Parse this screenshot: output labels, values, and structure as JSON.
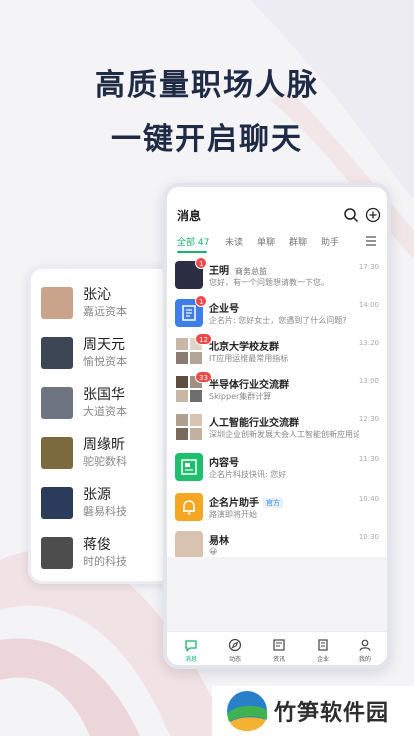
{
  "headline": {
    "line1": "高质量职场人脉",
    "line2": "一键开启聊天"
  },
  "contacts": [
    {
      "name": "张沁",
      "org": "嘉远资本",
      "avatar_color": "#c9a48a"
    },
    {
      "name": "周天元",
      "org": "愉悦资本",
      "avatar_color": "#3d4654"
    },
    {
      "name": "张国华",
      "org": "大道资本",
      "avatar_color": "#6e7480"
    },
    {
      "name": "周缘昕",
      "org": "驼驼数科",
      "avatar_color": "#7a6a3e"
    },
    {
      "name": "张源",
      "org": "磐易科技",
      "avatar_color": "#2a3b5c"
    },
    {
      "name": "蒋俊",
      "org": "时的科技",
      "avatar_color": "#4d4d4d"
    }
  ],
  "app": {
    "title": "消息",
    "icons": {
      "search": "search-icon",
      "add": "plus-circle-icon",
      "menu": "menu-icon"
    },
    "accent": "#19b26b",
    "tabs": [
      {
        "label": "全部 47",
        "active": true
      },
      {
        "label": "未读",
        "active": false
      },
      {
        "label": "单聊",
        "active": false
      },
      {
        "label": "群聊",
        "active": false
      },
      {
        "label": "助手",
        "active": false
      }
    ],
    "messages": [
      {
        "name": "王明",
        "title": "商务总监",
        "tag": "",
        "preview": "您好，有一个问题想请教一下您。",
        "time": "17:30",
        "badge": "1",
        "avatar": "person-photo",
        "avatar_color": "#2b2d42"
      },
      {
        "name": "企业号",
        "title": "",
        "tag": "",
        "preview": "企名片: 您好女士，您遇到了什么问题?",
        "time": "14:00",
        "badge": "1",
        "avatar": "enterprise-icon",
        "avatar_color": "#3f7ee8"
      },
      {
        "name": "北京大学校友群",
        "title": "",
        "tag": "",
        "preview": "IT应用运维最常用指标",
        "time": "13:20",
        "badge": "12",
        "avatar": "group-avatar",
        "avatar_color": "#c8b6a6"
      },
      {
        "name": "半导体行业交流群",
        "title": "",
        "tag": "",
        "preview": "Skipper集群计算",
        "time": "13:00",
        "badge": "33",
        "avatar": "group-avatar",
        "avatar_color": "#a09080"
      },
      {
        "name": "人工智能行业交流群",
        "title": "",
        "tag": "",
        "preview": "深圳企业创新发展大会人工智能创新应用论坛",
        "time": "12:30",
        "badge": "",
        "avatar": "group-avatar",
        "avatar_color": "#b0a090"
      },
      {
        "name": "内容号",
        "title": "",
        "tag": "",
        "preview": "企名片科技快讯: 您好",
        "time": "11:30",
        "badge": "",
        "avatar": "content-icon",
        "avatar_color": "#1fbf6e"
      },
      {
        "name": "企名片助手",
        "title": "",
        "tag": "官方",
        "preview": "路演即将开始",
        "time": "10:40",
        "badge": "",
        "avatar": "bell-icon",
        "avatar_color": "#f5a623"
      },
      {
        "name": "易林",
        "title": "",
        "tag": "",
        "preview": "😀",
        "time": "10:30",
        "badge": "",
        "avatar": "person-photo",
        "avatar_color": "#d9c2b0"
      }
    ],
    "nav": [
      {
        "label": "消息",
        "icon": "chat-icon",
        "active": true
      },
      {
        "label": "动态",
        "icon": "compass-icon",
        "active": false
      },
      {
        "label": "资讯",
        "icon": "news-icon",
        "active": false
      },
      {
        "label": "企业",
        "icon": "building-icon",
        "active": false
      },
      {
        "label": "我的",
        "icon": "user-icon",
        "active": false
      }
    ]
  },
  "watermark": {
    "text": "竹笋软件园",
    "icon": "watermark-logo"
  }
}
